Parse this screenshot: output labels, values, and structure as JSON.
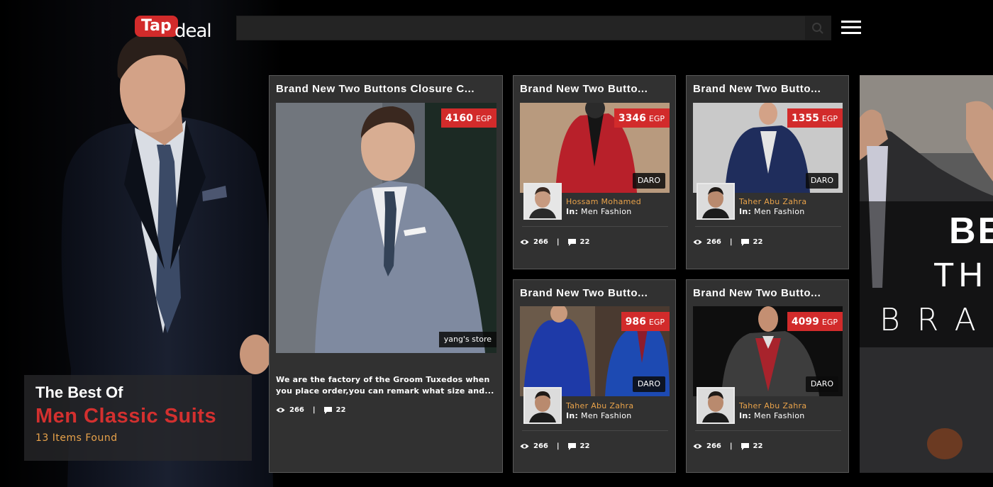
{
  "header": {
    "logo_part1": "Tap",
    "logo_part2": "deal",
    "search_placeholder": "",
    "search_icon": "search-icon",
    "menu_icon": "hamburger-menu-icon"
  },
  "hero": {
    "subtitle": "The Best Of",
    "title": "Men Classic Suits",
    "count": "13 Items Found"
  },
  "featured": {
    "title": "Brand New Two Buttons Closure C...",
    "price": "4160",
    "currency": "EGP",
    "store": "yang's store",
    "description_line1": "We are the factory of the Groom Tuxedos when",
    "description_line2": "you place order,you can remark what size and...",
    "views": "266",
    "comments": "22"
  },
  "products": [
    {
      "title": "Brand New Two Butto...",
      "price": "3346",
      "currency": "EGP",
      "brand": "DARO",
      "seller": "Hossam Mohamed",
      "category_prefix": "In:",
      "category": "Men Fashion",
      "views": "266",
      "comments": "22"
    },
    {
      "title": "Brand New Two Butto...",
      "price": "1355",
      "currency": "EGP",
      "brand": "DARO",
      "seller": "Taher Abu Zahra",
      "category_prefix": "In:",
      "category": "Men Fashion",
      "views": "266",
      "comments": "22"
    },
    {
      "title": "Brand New Two Butto...",
      "price": "986",
      "currency": "EGP",
      "brand": "DARO",
      "seller": "Taher Abu Zahra",
      "category_prefix": "In:",
      "category": "Men Fashion",
      "views": "266",
      "comments": "22"
    },
    {
      "title": "Brand New Two Butto...",
      "price": "4099",
      "currency": "EGP",
      "brand": "DARO",
      "seller": "Taher Abu Zahra",
      "category_prefix": "In:",
      "category": "Men Fashion",
      "views": "266",
      "comments": "22"
    }
  ],
  "banner": {
    "line1": "BE",
    "line2": "TH",
    "line3": "BRA"
  },
  "colors": {
    "accent_red": "#d22b2b",
    "seller_orange": "#e8a24a",
    "card_bg": "#313131"
  }
}
